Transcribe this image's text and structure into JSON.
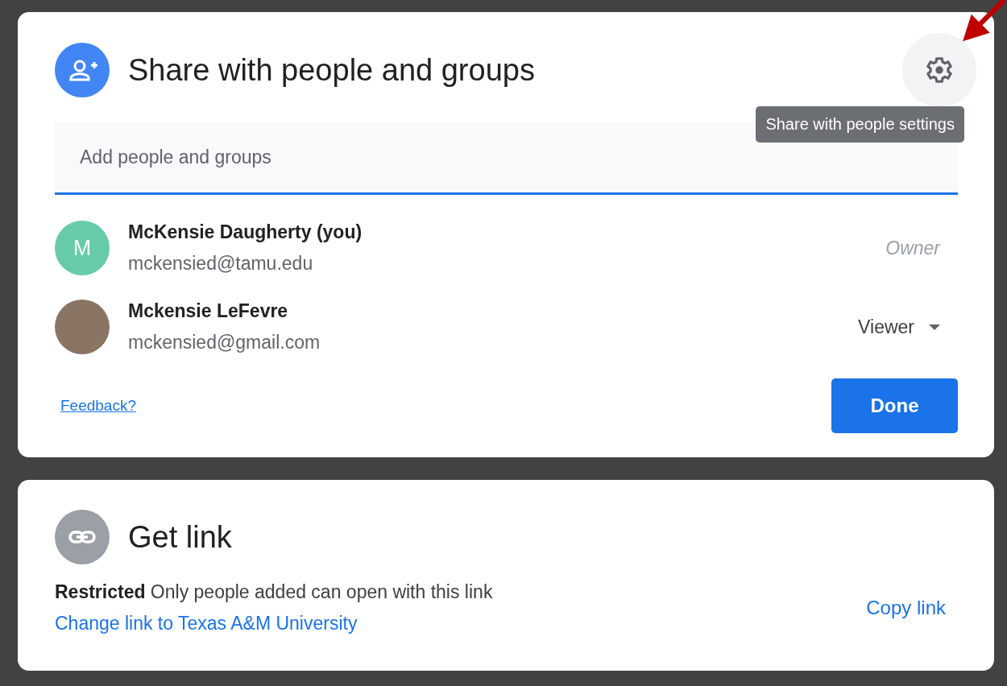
{
  "share_dialog": {
    "title": "Share with people and groups",
    "settings_tooltip": "Share with people settings",
    "search": {
      "placeholder": "Add people and groups"
    },
    "people": [
      {
        "kind": "letter",
        "initial": "M",
        "name": "McKensie Daugherty (you)",
        "email": "mckensied@tamu.edu",
        "role": "Owner",
        "role_menu": false
      },
      {
        "kind": "photo",
        "name": "Mckensie LeFevre",
        "email": "mckensied@gmail.com",
        "role": "Viewer",
        "role_menu": true
      }
    ],
    "feedback_link": "Feedback?",
    "done_button": "Done"
  },
  "link_dialog": {
    "title": "Get link",
    "description": "**Restricted** Only people added can open with this link",
    "change_link": "Change link to Texas A&M University",
    "copy_link": "Copy link"
  }
}
